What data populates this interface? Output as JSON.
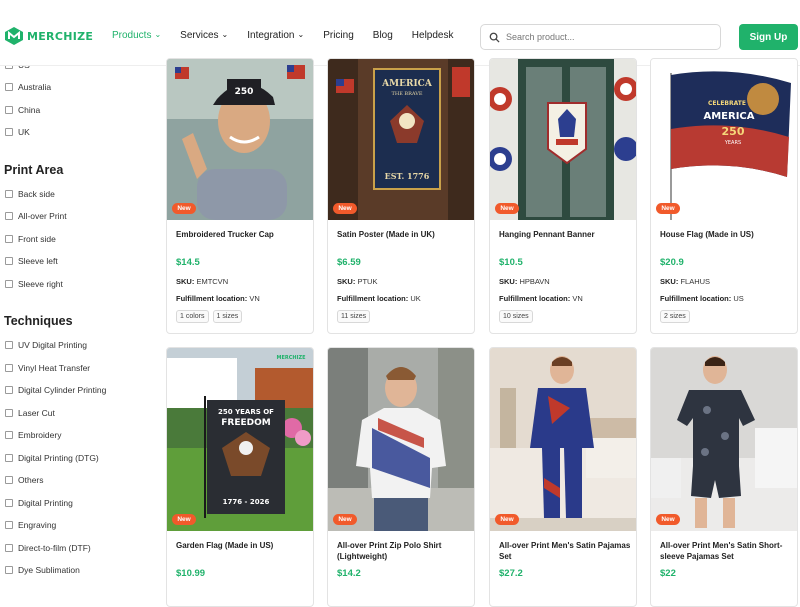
{
  "brand": {
    "name": "MERCHIZE",
    "color": "#20b26b"
  },
  "nav": [
    {
      "label": "Products",
      "dropdown": true,
      "active": true
    },
    {
      "label": "Services",
      "dropdown": true,
      "active": false
    },
    {
      "label": "Integration",
      "dropdown": true,
      "active": false
    },
    {
      "label": "Pricing",
      "dropdown": false,
      "active": false
    },
    {
      "label": "Blog",
      "dropdown": false,
      "active": false
    },
    {
      "label": "Helpdesk",
      "dropdown": false,
      "active": false
    }
  ],
  "search": {
    "placeholder": "Search product...",
    "icon": "search-icon"
  },
  "signup_label": "Sign Up",
  "sidebar": {
    "country_partial": "US",
    "countries": [
      "Australia",
      "China",
      "UK"
    ],
    "print_area_title": "Print Area",
    "print_areas": [
      "Back side",
      "All-over Print",
      "Front side",
      "Sleeve left",
      "Sleeve right"
    ],
    "techniques_title": "Techniques",
    "techniques": [
      "UV Digital Printing",
      "Vinyl Heat Transfer",
      "Digital Cylinder Printing",
      "Laser Cut",
      "Embroidery",
      "Digital Printing (DTG)",
      "Others",
      "Digital Printing",
      "Engraving",
      "Direct-to-film (DTF)",
      "Dye Sublimation"
    ]
  },
  "labels": {
    "sku": "SKU:",
    "fulfillment": "Fulfillment location:",
    "badge_new": "New"
  },
  "products": [
    {
      "title": "Embroidered Trucker Cap",
      "price": "$14.5",
      "sku": "EMTCVN",
      "location": "VN",
      "chips": [
        "1 colors",
        "1 sizes"
      ],
      "image_text": "250"
    },
    {
      "title": "Satin Poster (Made in UK)",
      "price": "$6.59",
      "sku": "PTUK",
      "location": "UK",
      "chips": [
        "11 sizes"
      ],
      "image_text": "AMERICA THE BRAVE · EST. 1776"
    },
    {
      "title": "Hanging Pennant Banner",
      "price": "$10.5",
      "sku": "HPBAVN",
      "location": "VN",
      "chips": [
        "10 sizes"
      ],
      "image_text": ""
    },
    {
      "title": "House Flag (Made in US)",
      "price": "$20.9",
      "sku": "FLAHUS",
      "location": "US",
      "chips": [
        "2 sizes"
      ],
      "image_text": "CELEBRATE AMERICA 250 YEARS"
    },
    {
      "title": "Garden Flag (Made in US)",
      "price": "$10.99",
      "image_text": "250 YEARS OF FREEDOM · 1776 - 2026",
      "watermark": "MERCHIZE"
    },
    {
      "title": "All-over Print Zip Polo Shirt (Lightweight)",
      "price": "$14.2"
    },
    {
      "title": "All-over Print Men's Satin Pajamas Set",
      "price": "$27.2"
    },
    {
      "title": "All-over Print Men's Satin Short-sleeve Pajamas Set",
      "price": "$22"
    }
  ]
}
